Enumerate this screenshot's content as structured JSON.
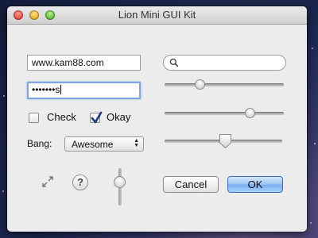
{
  "window": {
    "title": "Lion Mini GUI Kit"
  },
  "form": {
    "url_value": "www.kam88.com",
    "password_value": "•••••••s",
    "search_placeholder": ""
  },
  "checkboxes": [
    {
      "label": "Check",
      "checked": false
    },
    {
      "label": "Okay",
      "checked": true
    }
  ],
  "popup": {
    "label": "Bang:",
    "selected": "Awesome"
  },
  "sliders": {
    "slider1": 0.3,
    "slider2": 0.73,
    "slider3": 0.52,
    "vertical": 0.5
  },
  "buttons": {
    "help_label": "?",
    "cancel_label": "Cancel",
    "ok_label": "OK"
  },
  "colors": {
    "accent": "#79acef",
    "window": "#ececec"
  },
  "icons": [
    "search-icon",
    "checkmark-icon",
    "expand-icon",
    "updown-arrows-icon"
  ]
}
